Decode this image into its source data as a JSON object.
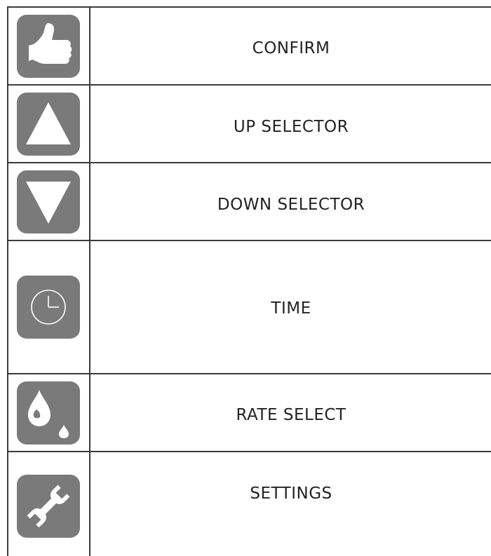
{
  "rows": [
    {
      "icon": "thumbs-up-icon",
      "label": "CONFIRM"
    },
    {
      "icon": "up-triangle-icon",
      "label": "UP SELECTOR"
    },
    {
      "icon": "down-triangle-icon",
      "label": "DOWN SELECTOR"
    },
    {
      "icon": "clock-icon",
      "label": "TIME"
    },
    {
      "icon": "drops-icon",
      "label": "RATE SELECT"
    },
    {
      "icon": "wrench-icon",
      "label": "SETTINGS"
    }
  ],
  "colors": {
    "icon_bg": "#7a7a7a",
    "icon_fg": "#ffffff",
    "line": "#3a3a3a",
    "text": "#222222"
  }
}
